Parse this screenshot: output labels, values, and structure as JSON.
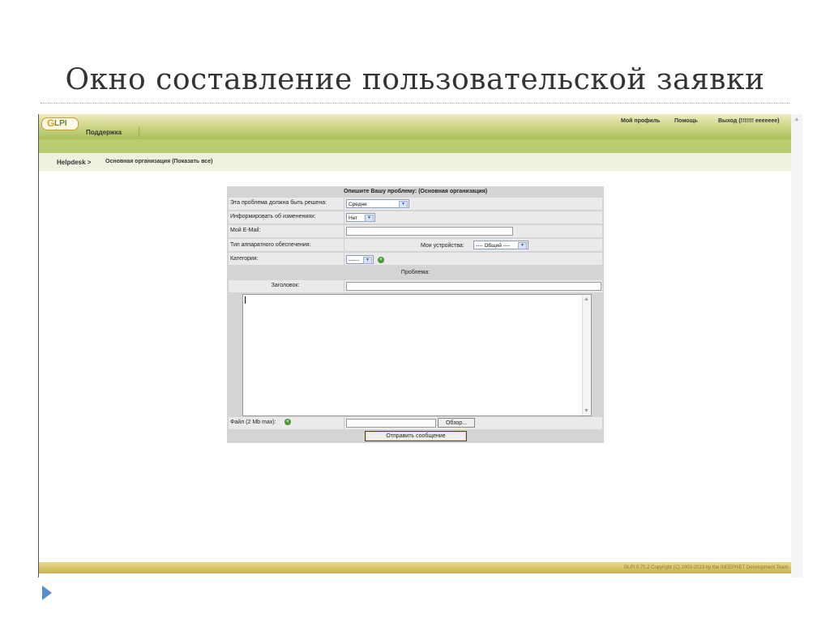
{
  "slide": {
    "title": "Окно составление пользовательской заявки"
  },
  "app": {
    "logo_g": "G",
    "logo_text": "LPI",
    "nav_support": "Поддержка",
    "top_links": {
      "profile": "Мой профиль",
      "help": "Помощь",
      "logout": "Выход (!!!!!!! eeeeeee)"
    },
    "breadcrumb": {
      "home": "Helpdesk >",
      "page": "Основная организация (Показать все)"
    },
    "footer": "GLPI 0.70.2 Copyright (C) 2003-2013 by the INDEPNET Development Team."
  },
  "form": {
    "title": "Опишите Вашу проблему: (Основная организация)",
    "urgency_label": "Эта проблема должна быть решена:",
    "urgency_value": "Средне",
    "notify_label": "Информировать об изменениях:",
    "notify_value": "Нет",
    "email_label": "Мой E-Mail:",
    "email_value": "",
    "hardware_label": "Тип аппаратного обеспечения:",
    "devices_label": "Мои устройства:",
    "devices_value": "---- Общий ----",
    "category_label": "Категория:",
    "category_value": "------",
    "problem_label": "Проблема:",
    "subject_label": "Заголовок:",
    "subject_value": "",
    "description_value": "",
    "file_label": "Файл (2 Mb max):",
    "browse_label": "Обзор...",
    "submit_label": "Отправить сообщение"
  },
  "icons": {
    "add": "add-icon",
    "dropdown": "chevron-down-icon",
    "slide_bullet": "play-triangle-icon"
  },
  "colors": {
    "header_green": "#b8cd70",
    "footer_gold": "#c8b050",
    "form_bg": "#d4d4d4"
  }
}
